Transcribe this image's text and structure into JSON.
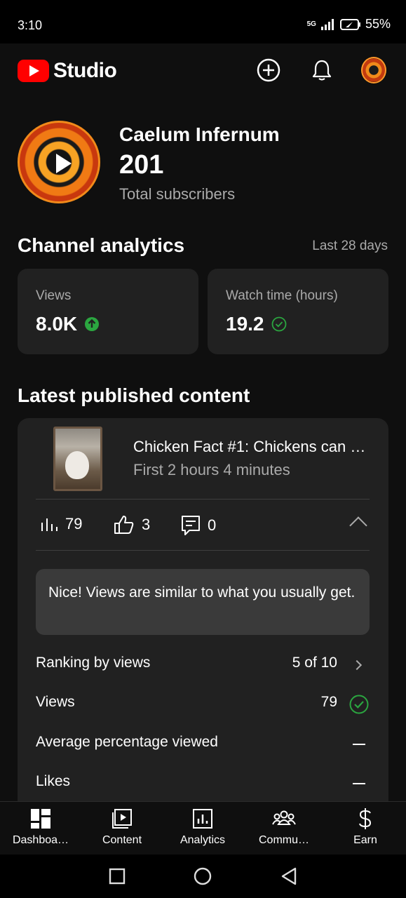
{
  "status_bar": {
    "time": "3:10",
    "network": "5G",
    "battery": "55%"
  },
  "app": {
    "name": "Studio"
  },
  "channel": {
    "name": "Caelum Infernum",
    "subscribers": "201",
    "subscribers_label": "Total subscribers"
  },
  "analytics": {
    "title": "Channel analytics",
    "period": "Last 28 days",
    "cards": [
      {
        "label": "Views",
        "value": "8.0K",
        "status_icon": "arrow-up-circle-icon"
      },
      {
        "label": "Watch time (hours)",
        "value": "19.2",
        "status_icon": "check-circle-icon"
      }
    ]
  },
  "latest": {
    "title": "Latest published content",
    "video_title": "Chicken Fact #1: Chickens can …",
    "video_subtitle": "First 2 hours 4 minutes",
    "views": "79",
    "likes": "3",
    "comments": "0",
    "insight": "Nice! Views are similar to what you usually get.",
    "rows": [
      {
        "label": "Ranking by views",
        "value": "5 of 10"
      },
      {
        "label": "Views",
        "value": "79"
      },
      {
        "label": "Average percentage viewed",
        "value": "—"
      },
      {
        "label": "Likes",
        "value": "—"
      }
    ]
  },
  "bottom_nav": [
    {
      "label": "Dashboa…",
      "icon": "dashboard-icon"
    },
    {
      "label": "Content",
      "icon": "content-icon"
    },
    {
      "label": "Analytics",
      "icon": "analytics-icon"
    },
    {
      "label": "Commu…",
      "icon": "community-icon"
    },
    {
      "label": "Earn",
      "icon": "earn-icon"
    }
  ],
  "colors": {
    "brand": "#ff0000",
    "success": "#2ba640",
    "card": "#212121",
    "background": "#0f0f0f"
  }
}
